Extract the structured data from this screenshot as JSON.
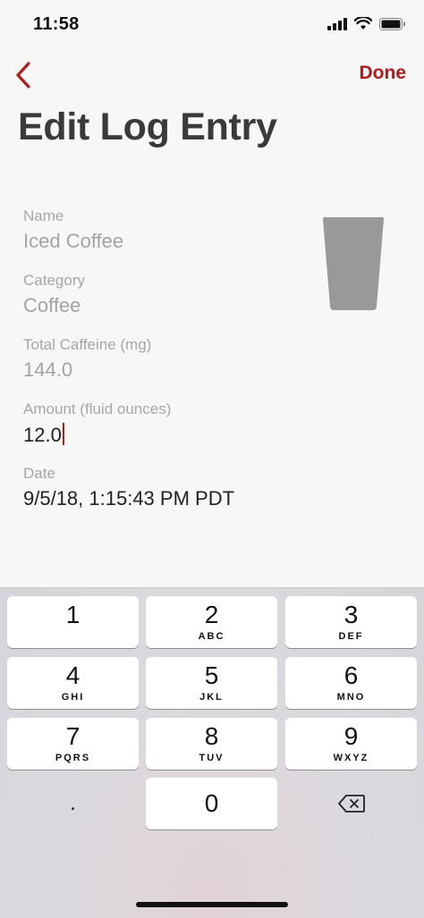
{
  "status_bar": {
    "time": "11:58"
  },
  "nav": {
    "done_label": "Done"
  },
  "title": "Edit Log Entry",
  "fields": [
    {
      "label": "Name",
      "value": "Iced Coffee"
    },
    {
      "label": "Category",
      "value": "Coffee"
    },
    {
      "label": "Total Caffeine (mg)",
      "value": "144.0"
    },
    {
      "label": "Amount (fluid ounces)",
      "value": "12.0"
    },
    {
      "label": "Date",
      "value": "9/5/18, 1:15:43 PM PDT"
    }
  ],
  "keypad": {
    "keys": [
      {
        "digit": "1",
        "letters": ""
      },
      {
        "digit": "2",
        "letters": "ABC"
      },
      {
        "digit": "3",
        "letters": "DEF"
      },
      {
        "digit": "4",
        "letters": "GHI"
      },
      {
        "digit": "5",
        "letters": "JKL"
      },
      {
        "digit": "6",
        "letters": "MNO"
      },
      {
        "digit": "7",
        "letters": "PQRS"
      },
      {
        "digit": "8",
        "letters": "TUV"
      },
      {
        "digit": "9",
        "letters": "WXYZ"
      }
    ],
    "decimal": ".",
    "zero": "0"
  },
  "colors": {
    "accent": "#b01c1c",
    "background": "#f7f7f7",
    "cup": "#999999"
  }
}
